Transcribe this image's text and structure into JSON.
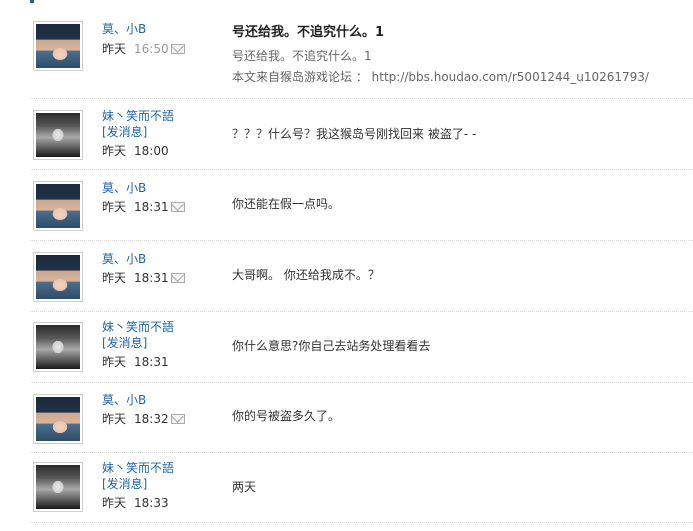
{
  "posts": [
    {
      "author": "莫、小B",
      "day": "昨天",
      "time": "16:50",
      "title": "号还给我。不追究什么。1",
      "body": "号还给我。不追究什么。1",
      "source_prefix": "本文来自猴岛游戏论坛 ：",
      "source_url": "http://bbs.houdao.com/r5001244_u10261793/"
    },
    {
      "author": "妹丶笑而不語",
      "message_link": "[发消息]",
      "day": "昨天",
      "time": "18:00",
      "body": "？？？什么号？我这猴岛号刚找回来  被盗了- -"
    },
    {
      "author": "莫、小B",
      "day": "昨天",
      "time": "18:31",
      "body": "你还能在假一点吗。"
    },
    {
      "author": "莫、小B",
      "day": "昨天",
      "time": "18:31",
      "body": "大哥啊。  你还给我成不。？"
    },
    {
      "author": "妹丶笑而不語",
      "message_link": "[发消息]",
      "day": "昨天",
      "time": "18:31",
      "body": "你什么意思?你自己去站务处理看看去"
    },
    {
      "author": "莫、小B",
      "day": "昨天",
      "time": "18:32",
      "body": "你的号被盗多久了。"
    },
    {
      "author": "妹丶笑而不語",
      "message_link": "[发消息]",
      "day": "昨天",
      "time": "18:33",
      "body": "两天"
    }
  ],
  "icons": {
    "mail": "envelope-icon"
  },
  "colors": {
    "link": "#2266aa",
    "text": "#333333",
    "muted": "#999999",
    "divider": "#dcdcdc"
  }
}
